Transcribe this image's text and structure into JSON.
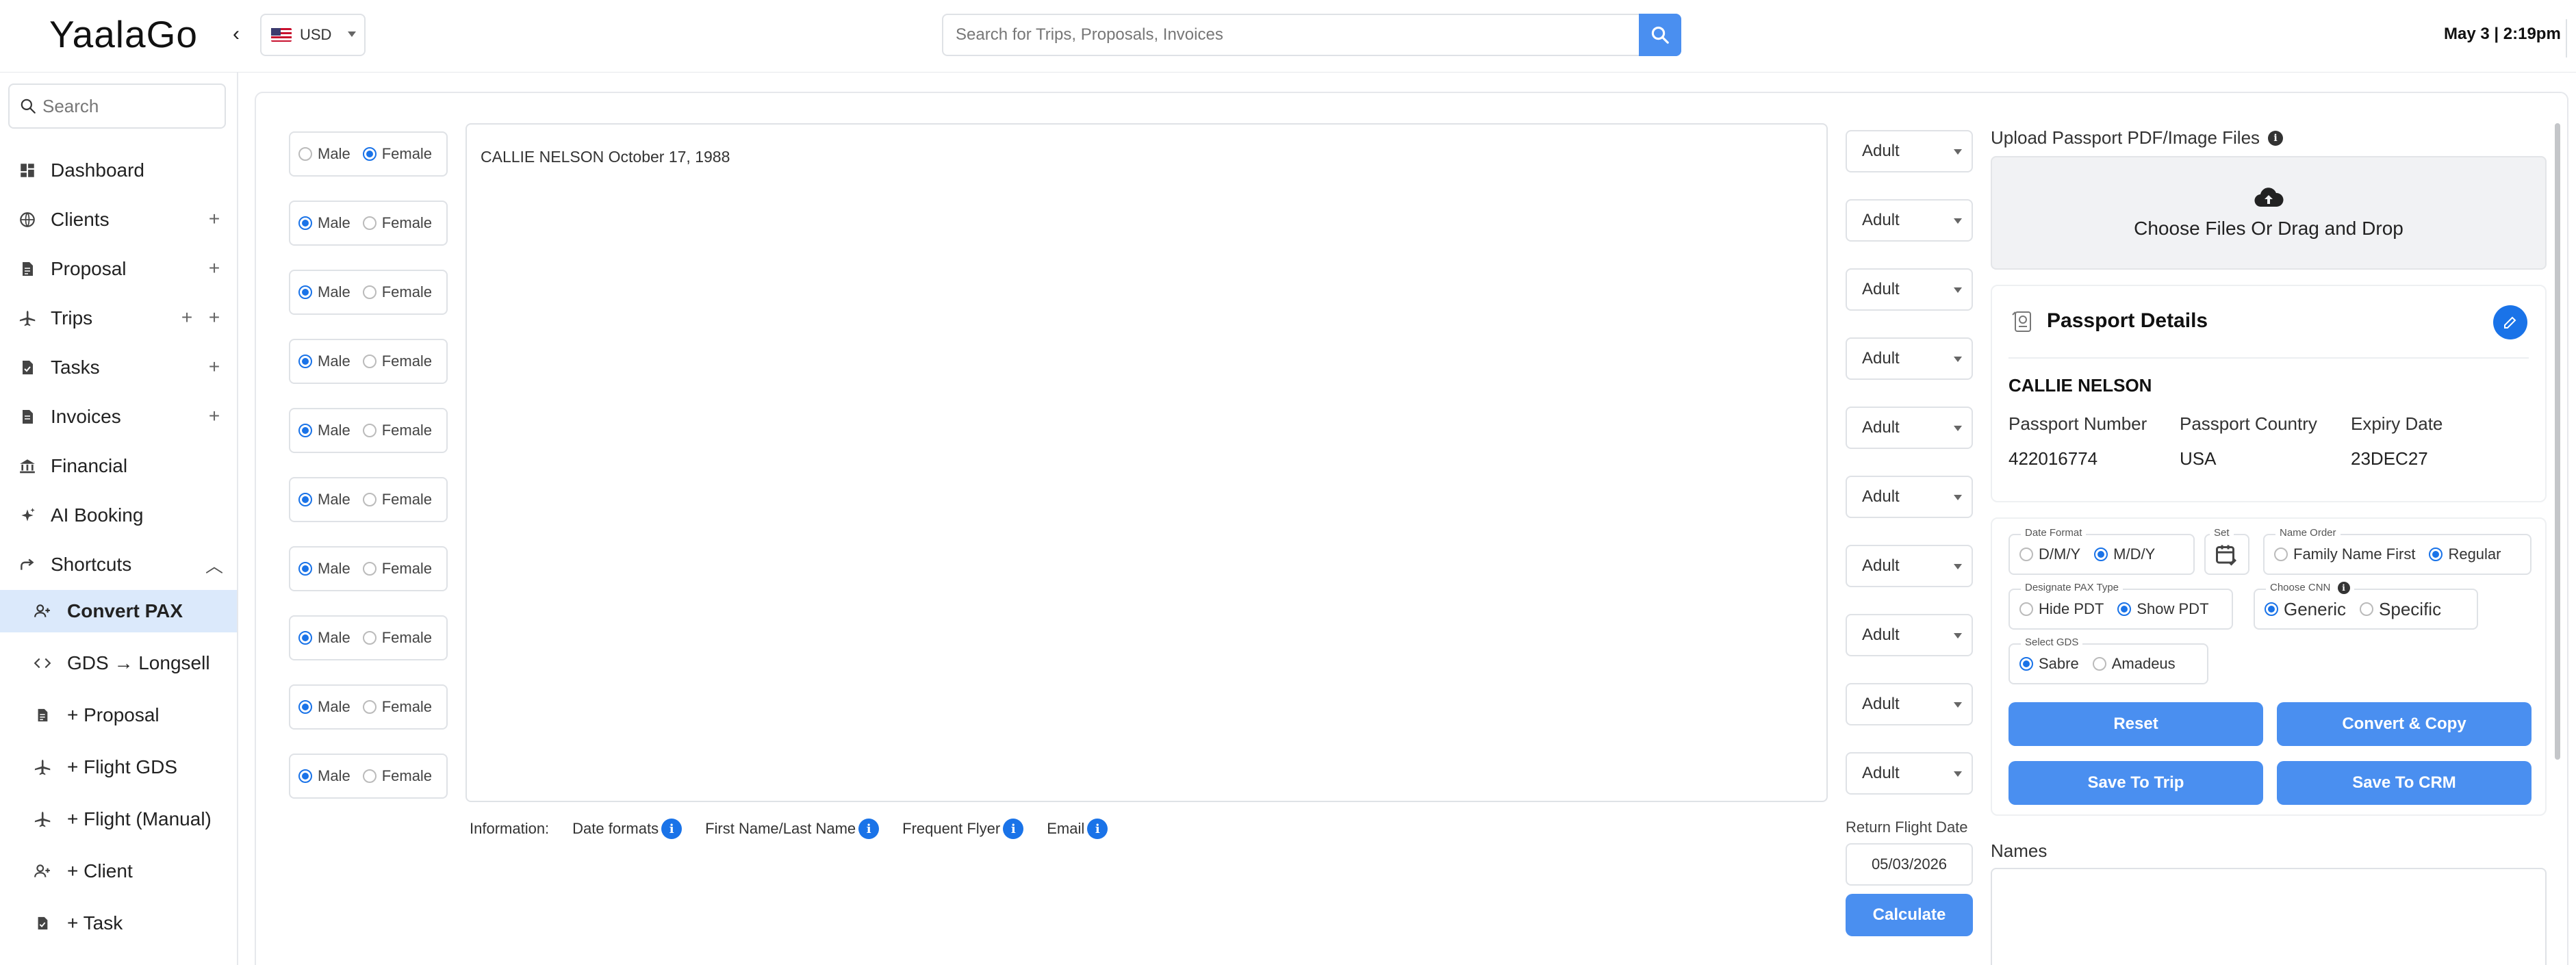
{
  "app": {
    "logo": "YaalaGo",
    "datetime": "May 3 | 2:19pm"
  },
  "header": {
    "currency": "USD",
    "search_placeholder": "Search for Trips, Proposals, Invoices"
  },
  "sidebar": {
    "search_placeholder": "Search",
    "items": [
      {
        "label": "Dashboard",
        "icon": "dashboard-icon"
      },
      {
        "label": "Clients",
        "icon": "globe-icon"
      },
      {
        "label": "Proposal",
        "icon": "document-icon"
      },
      {
        "label": "Trips",
        "icon": "plane-icon"
      },
      {
        "label": "Tasks",
        "icon": "task-icon"
      },
      {
        "label": "Invoices",
        "icon": "invoice-icon"
      },
      {
        "label": "Financial",
        "icon": "bank-icon"
      },
      {
        "label": "AI Booking",
        "icon": "sparkle-icon"
      },
      {
        "label": "Shortcuts",
        "icon": "share-arrow-icon"
      }
    ],
    "shortcuts": [
      {
        "label": "Convert PAX",
        "icon": "person-add-icon"
      },
      {
        "label": "GDS → Longsell",
        "icon": "code-icon"
      },
      {
        "label": "+ Proposal",
        "icon": "document-icon"
      },
      {
        "label": "+ Flight GDS",
        "icon": "plane-icon"
      },
      {
        "label": "+ Flight (Manual)",
        "icon": "plane-icon"
      },
      {
        "label": "+ Client",
        "icon": "person-add-icon"
      },
      {
        "label": "+ Task",
        "icon": "task-icon"
      }
    ]
  },
  "main": {
    "gender_labels": {
      "male": "Male",
      "female": "Female"
    },
    "passengers": [
      {
        "gender": "female",
        "age": "Adult"
      },
      {
        "gender": "male",
        "age": "Adult"
      },
      {
        "gender": "male",
        "age": "Adult"
      },
      {
        "gender": "male",
        "age": "Adult"
      },
      {
        "gender": "male",
        "age": "Adult"
      },
      {
        "gender": "male",
        "age": "Adult"
      },
      {
        "gender": "male",
        "age": "Adult"
      },
      {
        "gender": "male",
        "age": "Adult"
      },
      {
        "gender": "male",
        "age": "Adult"
      },
      {
        "gender": "male",
        "age": "Adult"
      }
    ],
    "paste_text": "CALLIE NELSON October 17, 1988",
    "info": {
      "label": "Information:",
      "items": [
        "Date formats",
        "First Name/Last Name",
        "Frequent Flyer",
        "Email"
      ]
    },
    "return_flight": {
      "label": "Return Flight Date",
      "value": "05/03/2026",
      "calculate": "Calculate"
    }
  },
  "right": {
    "upload_label": "Upload Passport PDF/Image Files",
    "dropzone_text": "Choose Files Or Drag and Drop",
    "passport": {
      "title": "Passport Details",
      "name": "CALLIE NELSON",
      "fields": [
        {
          "label": "Passport Number",
          "value": "422016774"
        },
        {
          "label": "Passport Country",
          "value": "USA"
        },
        {
          "label": "Expiry Date",
          "value": "23DEC27"
        }
      ]
    },
    "settings": {
      "date_format": {
        "legend": "Date Format",
        "options": [
          "D/M/Y",
          "M/D/Y"
        ],
        "selected": "M/D/Y"
      },
      "set_legend": "Set",
      "name_order": {
        "legend": "Name Order",
        "options": [
          "Family Name First",
          "Regular"
        ],
        "selected": "Regular"
      },
      "pax_type": {
        "legend": "Designate PAX Type",
        "options": [
          "Hide PDT",
          "Show PDT"
        ],
        "selected": "Show PDT"
      },
      "cnn": {
        "legend": "Choose CNN",
        "options": [
          "Generic",
          "Specific"
        ],
        "selected": "Generic"
      },
      "gds": {
        "legend": "Select GDS",
        "options": [
          "Sabre",
          "Amadeus"
        ],
        "selected": "Sabre"
      }
    },
    "buttons": {
      "reset": "Reset",
      "convert_copy": "Convert & Copy",
      "save_trip": "Save To Trip",
      "save_crm": "Save To CRM"
    },
    "names_label": "Names"
  },
  "colors": {
    "accent": "#1a73e8",
    "button": "#4a8ff0",
    "active_nav_bg": "#dbe9fb"
  }
}
